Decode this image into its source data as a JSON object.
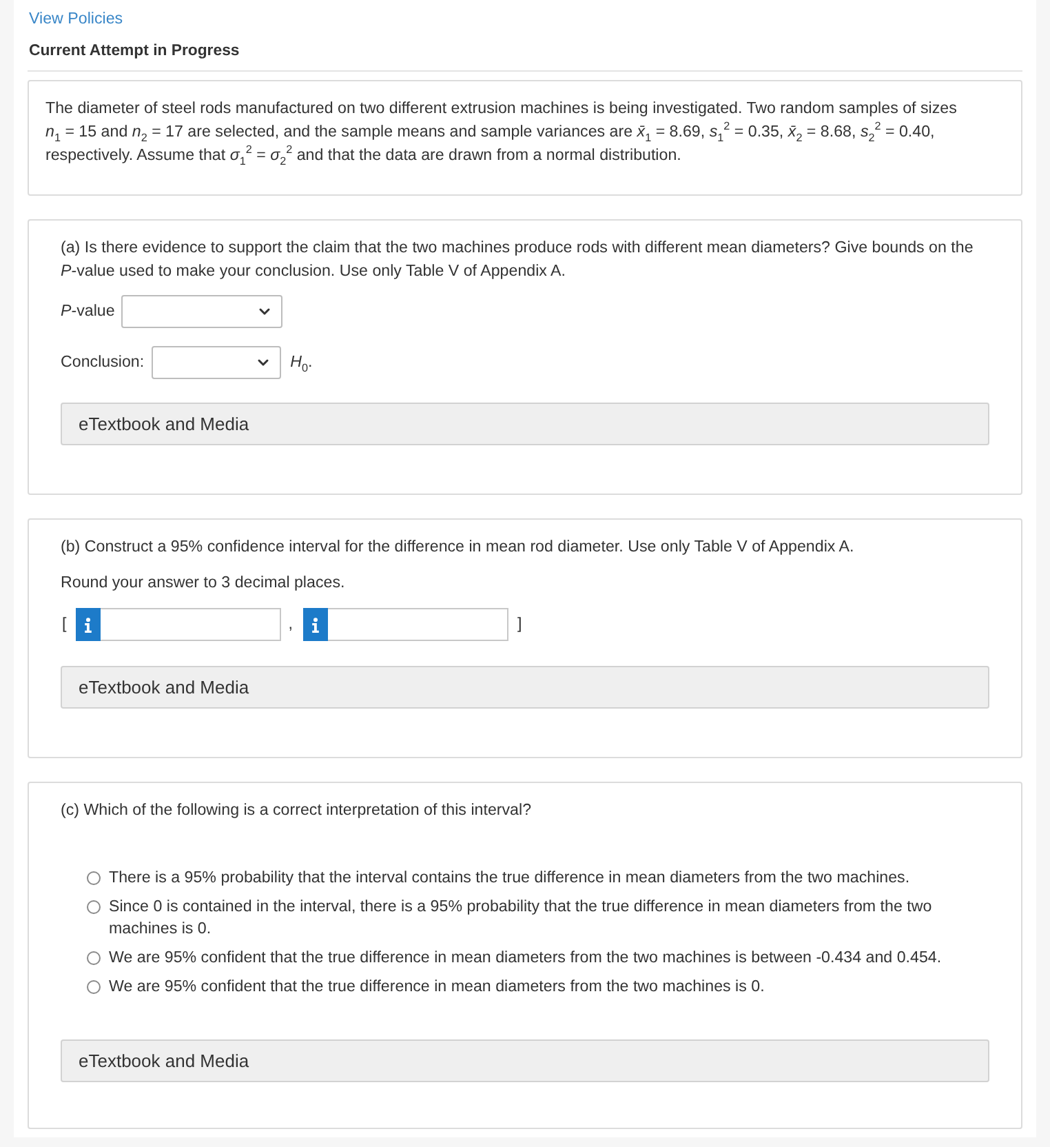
{
  "header": {
    "link": "View Policies",
    "status": "Current Attempt in Progress"
  },
  "problem": {
    "text": "The diameter of steel rods manufactured on two different extrusion machines is being investigated. Two random samples of sizes *n*$_{1}$ = 15 and *n*$_{2}$ = 17 are selected, and the sample means and sample variances are *x̄*$_{1}$ = 8.69, *s*$_{1}$$^{2}$ = 0.35, *x̄*$_{2}$ = 8.68, *s*$_{2}$$^{2}$ = 0.40, respectively. Assume that *σ*$_{1}$$^{2}$ = *σ*$_{2}$$^{2}$ and that the data are drawn from a normal distribution."
  },
  "part_a": {
    "question": "(a) Is there evidence to support the claim that the two machines produce rods with different mean diameters? Give bounds on the *P*-value used to make your conclusion. Use only Table V of Appendix A.",
    "fields": [
      {
        "kind": "select",
        "label": "*P*-value"
      },
      {
        "kind": "select",
        "label": "Conclusion:",
        "suffix": "*H*$_{0}$."
      }
    ],
    "resource_button": "eTextbook and Media"
  },
  "part_b": {
    "question": "(b) Construct a 95% confidence interval for the difference in mean rod diameter. Use only Table V of Appendix A.",
    "instruction": "Round your answer to 3 decimal places.",
    "interval": {
      "open": "[",
      "separator": ",",
      "close": "]"
    },
    "resource_button": "eTextbook and Media"
  },
  "part_c": {
    "question": "(c) Which of the following is a correct interpretation of this interval?",
    "options": [
      {
        "label": "There is a 95% probability that the interval contains the true difference in mean diameters from the two machines.",
        "selected": false
      },
      {
        "label": "Since 0 is contained in the interval, there is a 95% probability that the true difference in mean diameters from the two machines is 0.",
        "selected": false
      },
      {
        "label": "We are 95% confident that the true difference in mean diameters from the two machines is between -0.434 and 0.454.",
        "selected": false
      },
      {
        "label": "We are 95% confident that the true difference in mean diameters from the two machines is 0.",
        "selected": false
      }
    ],
    "resource_button": "eTextbook and Media"
  }
}
